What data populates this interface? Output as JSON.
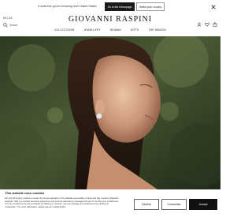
{
  "topbar": {
    "message": "It looks like you're browsing from United States",
    "store_button": "Go to the Homepage",
    "country_button": "Select your country",
    "close_label": "×"
  },
  "header": {
    "language": "EN | US",
    "search_label": "Search",
    "brand": "GIOVANNI RASPINI"
  },
  "nav": {
    "items": [
      "COLLECTIONS",
      "JEWELLERY",
      "WOMAN",
      "GIFTS",
      "THE MAISON"
    ]
  },
  "cookie": {
    "title": "This website uses cookies",
    "body": "We and third-party cookies to ensure the proper operation of the website, personalize content and ads, conduct statistical analyses, offer you a better browsing experience and propose advertising messages that are in line with your preferences. You can consent to the use of cookies by clicking on \"Accept\"; you can manage your preferences by clicking on \"Customise\". For more information, please see our Cookie Policy.",
    "decline": "Decline",
    "customise": "Customise",
    "accept": "Accept"
  }
}
